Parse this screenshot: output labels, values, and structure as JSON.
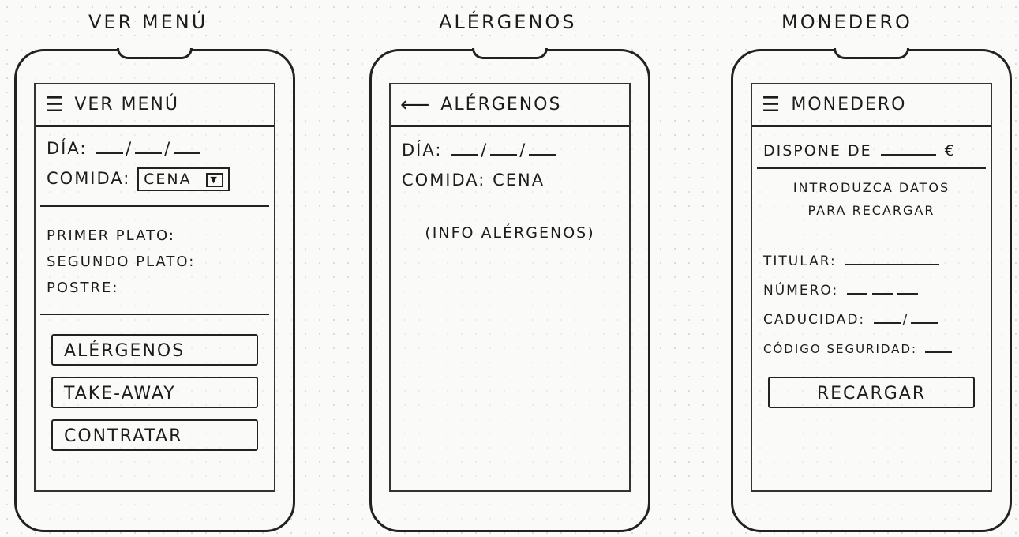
{
  "titles": {
    "menu": "VER MENÚ",
    "alergenos": "ALÉRGENOS",
    "monedero": "MONEDERO"
  },
  "menu_screen": {
    "appbar_icon": "hamburger-icon",
    "appbar_title": "VER MENÚ",
    "dia_label": "DÍA:",
    "comida_label": "COMIDA:",
    "comida_value": "CENA",
    "primer_plato": "PRIMER PLATO:",
    "segundo_plato": "SEGUNDO PLATO:",
    "postre": "POSTRE:",
    "buttons": {
      "alergenos": "ALÉRGENOS",
      "takeaway": "TAKE-AWAY",
      "contratar": "CONTRATAR"
    }
  },
  "alergenos_screen": {
    "appbar_icon": "back-arrow-icon",
    "appbar_title": "ALÉRGENOS",
    "dia_label": "DÍA:",
    "comida_label": "COMIDA:",
    "comida_value": "CENA",
    "info": "(INFO ALÉRGENOS)"
  },
  "monedero_screen": {
    "appbar_icon": "hamburger-icon",
    "appbar_title": "MONEDERO",
    "dispone_label": "DISPONE DE",
    "currency": "€",
    "introduzca_line1": "INTRODUZCA DATOS",
    "introduzca_line2": "PARA RECARGAR",
    "titular_label": "TITULAR:",
    "numero_label": "NÚMERO:",
    "caducidad_label": "CADUCIDAD:",
    "codigo_label": "CÓDIGO SEGURIDAD:",
    "recargar_button": "RECARGAR"
  }
}
